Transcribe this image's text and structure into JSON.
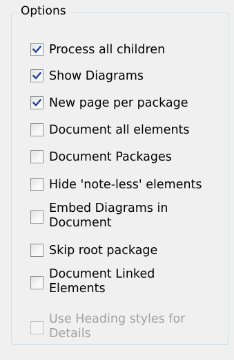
{
  "options_group": {
    "title": "Options",
    "items": [
      {
        "label": "Process all children",
        "checked": true,
        "enabled": true
      },
      {
        "label": "Show Diagrams",
        "checked": true,
        "enabled": true
      },
      {
        "label": "New page per package",
        "checked": true,
        "enabled": true
      },
      {
        "label": "Document all elements",
        "checked": false,
        "enabled": true
      },
      {
        "label": "Document Packages",
        "checked": false,
        "enabled": true
      },
      {
        "label": "Hide 'note-less' elements",
        "checked": false,
        "enabled": true
      },
      {
        "label": "Embed Diagrams in\nDocument",
        "checked": false,
        "enabled": true
      },
      {
        "label": "Skip root package",
        "checked": false,
        "enabled": true
      },
      {
        "label": "Document Linked\nElements",
        "checked": false,
        "enabled": true
      },
      {
        "label": "Use Heading styles for\nDetails",
        "checked": false,
        "enabled": false
      }
    ]
  },
  "colors": {
    "check_mark": "#21409a",
    "disabled_text": "#a0a0a0"
  }
}
